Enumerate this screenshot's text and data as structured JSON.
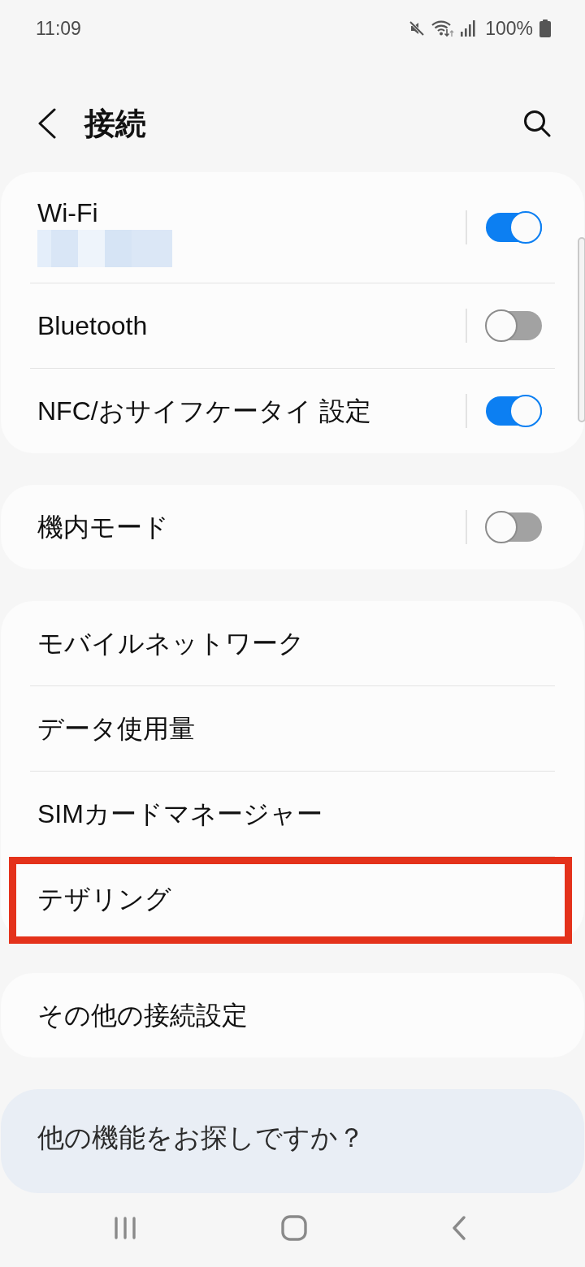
{
  "status_bar": {
    "time": "11:09",
    "battery": "100%"
  },
  "header": {
    "title": "接続"
  },
  "cards": [
    {
      "items": [
        {
          "kind": "toggle",
          "label": "Wi-Fi",
          "subtitle_pixelated": true,
          "on": true
        },
        {
          "kind": "toggle",
          "label": "Bluetooth",
          "on": false
        },
        {
          "kind": "toggle",
          "label": "NFC/おサイフケータイ 設定",
          "on": true
        }
      ]
    },
    {
      "items": [
        {
          "kind": "toggle",
          "label": "機内モード",
          "on": false
        }
      ]
    },
    {
      "items": [
        {
          "kind": "link",
          "label": "モバイルネットワーク"
        },
        {
          "kind": "link",
          "label": "データ使用量"
        },
        {
          "kind": "link",
          "label": "SIMカードマネージャー"
        },
        {
          "kind": "link",
          "label": "テザリング",
          "highlighted": true
        }
      ]
    },
    {
      "items": [
        {
          "kind": "link",
          "label": "その他の接続設定"
        }
      ]
    }
  ],
  "prompt": {
    "text": "他の機能をお探しですか？"
  }
}
